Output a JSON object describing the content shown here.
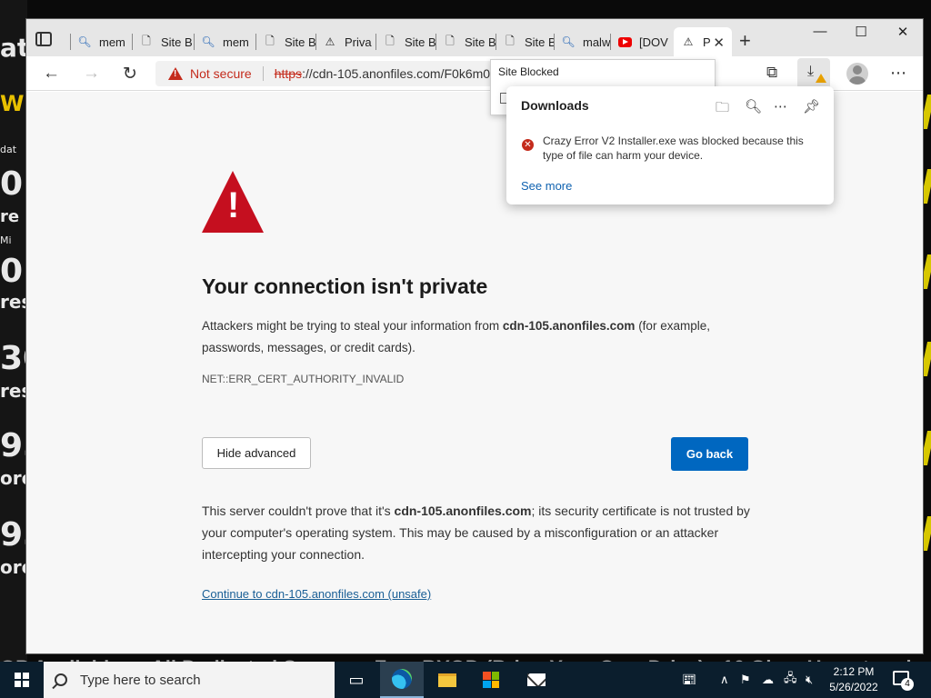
{
  "browser": {
    "tabs": [
      {
        "label": "mem",
        "icon": "search-icon"
      },
      {
        "label": "Site B",
        "icon": "page-icon"
      },
      {
        "label": "mem",
        "icon": "search-icon"
      },
      {
        "label": "Site B",
        "icon": "page-icon"
      },
      {
        "label": "Priva",
        "icon": "warning-page-icon"
      },
      {
        "label": "Site B",
        "icon": "page-icon"
      },
      {
        "label": "Site B",
        "icon": "page-icon"
      },
      {
        "label": "Site B",
        "icon": "page-icon"
      },
      {
        "label": "malw",
        "icon": "search-icon"
      },
      {
        "label": "[DOV",
        "icon": "youtube-icon"
      },
      {
        "label": "P",
        "icon": "warning-page-icon",
        "active": true
      }
    ],
    "window_controls": {
      "minimize": "—",
      "maximize": "☐",
      "close": "✕"
    },
    "address": {
      "security_label": "Not secure",
      "scheme": "https",
      "url_rest": "://cdn-105.anonfiles.com/F0k6m0"
    },
    "tooltip": "Site Blocked"
  },
  "page": {
    "heading": "Your connection isn't private",
    "intro_prefix": "Attackers might be trying to steal your information from ",
    "domain": "cdn-105.anonfiles.com",
    "intro_suffix": " (for example, passwords, messages, or credit cards).",
    "error_code": "NET::ERR_CERT_AUTHORITY_INVALID",
    "hide_advanced": "Hide advanced",
    "go_back": "Go back",
    "detail_prefix": "This server couldn't prove that it's ",
    "detail_suffix": "; its security certificate is not trusted by your computer's operating system. This may be caused by a misconfiguration or an attacker intercepting your connection.",
    "continue_link": "Continue to cdn-105.anonfiles.com (unsafe)"
  },
  "downloads": {
    "title": "Downloads",
    "message": "Crazy Error V2 Installer.exe was blocked because this type of file can harm your device.",
    "see_more": "See more"
  },
  "taskbar": {
    "search_placeholder": "Type here to search",
    "time": "2:12 PM",
    "date": "5/26/2022",
    "notification_count": "4"
  },
  "colors": {
    "danger": "#c42b1c",
    "primary": "#0067c0",
    "taskbar": "#0b1e2d"
  }
}
